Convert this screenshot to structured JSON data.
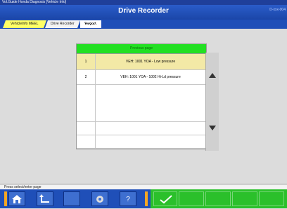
{
  "window": {
    "title": "Vol.Guide  Honda Diagnosis  [Vehicle Info]"
  },
  "header": {
    "title": "Drive Recorder",
    "right_text": "D-xxx-004"
  },
  "tabs": [
    {
      "label": "VehicleInfo MEEL"
    },
    {
      "label": "Drive Recorder"
    },
    {
      "label": "Report"
    }
  ],
  "table": {
    "header": "Previous page",
    "rows": [
      {
        "num": "1",
        "label": "VEH: 1001 YOA - Low pressure",
        "selected": true
      },
      {
        "num": "2",
        "label": "VEH: 1001 YOA - 1002 Hi-Ld pressure",
        "selected": false
      }
    ]
  },
  "status": {
    "text": "Press select/enter page"
  },
  "bottom": {
    "home_icon": "home-icon",
    "back_icon": "back-icon",
    "gear_icon": "gear-icon",
    "help_icon": "help-icon",
    "help_label": "?",
    "ok_icon": "check-icon"
  },
  "colors": {
    "header_blue": "#1b46a8",
    "table_header_green": "#22e022",
    "selected_row": "#f3e9a6",
    "bottom_green": "#2bc02b",
    "accent_orange": "#f5a623"
  }
}
